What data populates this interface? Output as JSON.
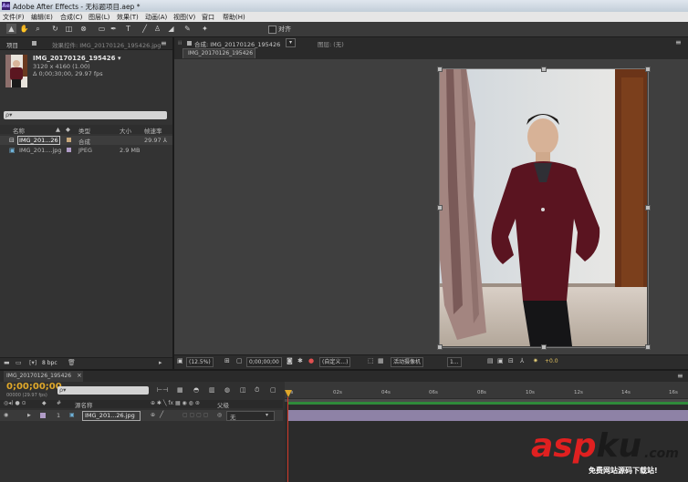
{
  "window": {
    "app_icon": "Ae",
    "title": "Adobe After Effects - 无标题项目.aep *"
  },
  "menu": [
    "文件(F)",
    "编辑(E)",
    "合成(C)",
    "图层(L)",
    "效果(T)",
    "动画(A)",
    "视图(V)",
    "窗口",
    "帮助(H)"
  ],
  "toolbar": {
    "icons": [
      "selection-tool-icon",
      "hand-tool-icon",
      "zoom-tool-icon",
      "rotate-tool-icon",
      "camera-tool-icon",
      "pan-behind-tool-icon",
      "rectangle-tool-icon",
      "pen-tool-icon",
      "type-tool-icon",
      "brush-tool-icon",
      "clone-stamp-tool-icon",
      "eraser-tool-icon",
      "roto-brush-tool-icon",
      "puppet-tool-icon"
    ],
    "align_label": "对齐"
  },
  "project_panel": {
    "tab_project": "项目",
    "tab_effects": "效果控件: IMG_20170126_195426.jpg",
    "selected_name": "IMG_20170126_195426 ▾",
    "selected_info1": "3120 x 4160 (1.00)",
    "selected_info2": "Δ 0;00;30;00, 29.97 fps",
    "search_placeholder": "ρ▾",
    "columns": {
      "name": "名称",
      "type": "类型",
      "size": "大小",
      "fps": "帧速率"
    },
    "items": [
      {
        "name": "IMG_201...26",
        "type": "合成",
        "size": "",
        "fps": "29.97",
        "color": "#c7a77a"
      },
      {
        "name": "IMG_201....jpg",
        "type": "JPEG",
        "size": "2.9 MB",
        "fps": "",
        "color": "#b09cc7"
      }
    ],
    "bpc": "8 bpc"
  },
  "composition_panel": {
    "tab_comp": "合成: IMG_20170126_195426",
    "tab_layer": "图层: (无)",
    "subtab": "IMG_20170126_195426",
    "zoom": "(12.5%)",
    "timecode": "0;00;00;00",
    "resolution": "(自定义...)",
    "camera": "活动摄像机",
    "views": "1...",
    "exposure": "+0.0"
  },
  "timeline_panel": {
    "tab": "IMG_20170126_195426",
    "current_time": "0;00;00;00",
    "frame_info": "00000 (29.97 fps)",
    "search_placeholder": "ρ▾",
    "col_source": "源名称",
    "col_parent": "父级",
    "layer_index": "1",
    "layer_name": "IMG_201...26.jpg",
    "parent_value": "无",
    "ruler": [
      "0s",
      "02s",
      "04s",
      "06s",
      "08s",
      "10s",
      "12s",
      "14s",
      "16s"
    ]
  },
  "watermark": {
    "brand_red": "asp",
    "brand_black": "ku",
    "domain": ".com",
    "tagline": "免费网站源码下载站!"
  }
}
